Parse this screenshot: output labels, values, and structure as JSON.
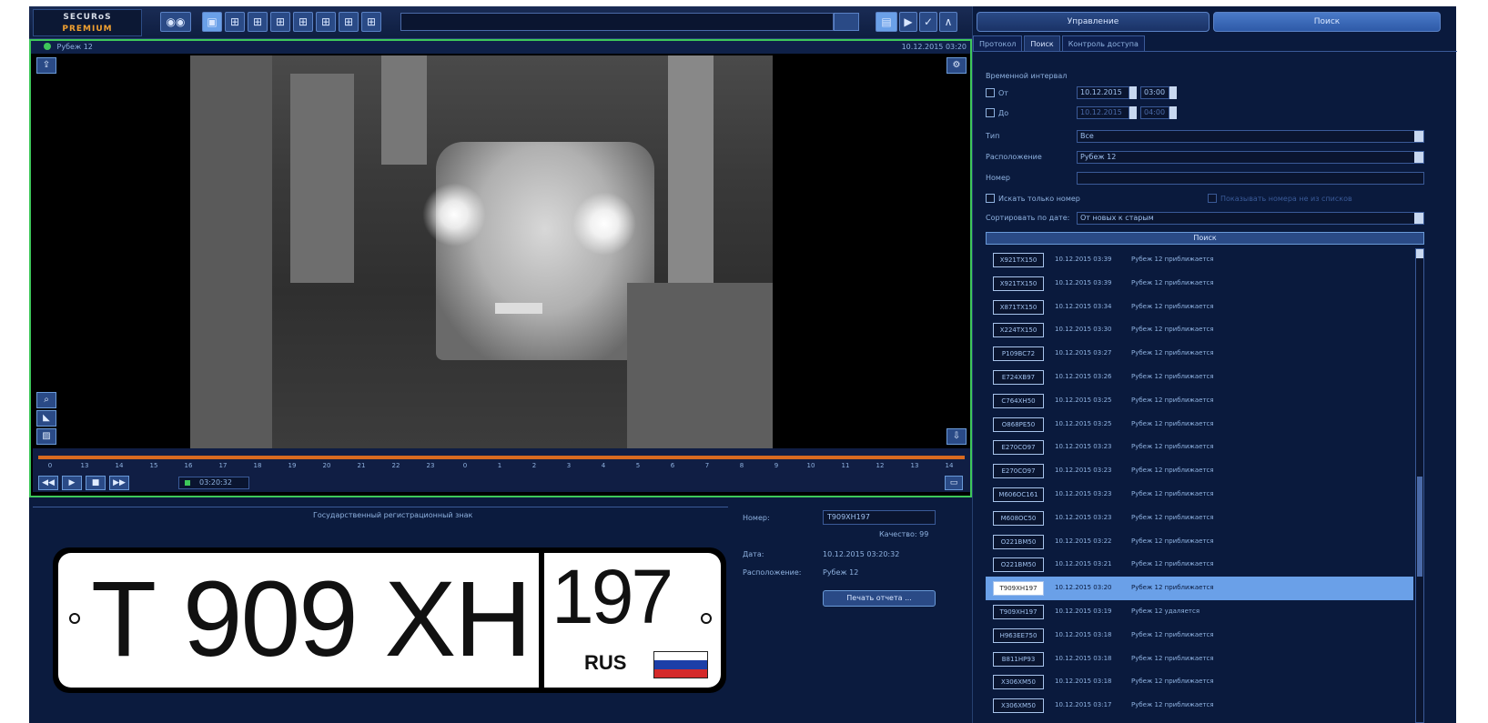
{
  "logo": {
    "line1": "SECURoS",
    "line2": "PREMIUM"
  },
  "toolbar": {
    "layout_buttons": [
      "◉◉",
      "▣",
      "⊞",
      "⊞",
      "⊞",
      "⊞",
      "⊞",
      "⊞",
      "⊞"
    ],
    "right_buttons": [
      "▤",
      "▶",
      "✓",
      "∧"
    ]
  },
  "camera": {
    "name": "Рубеж 12",
    "timestamp": "10.12.2015 03:20"
  },
  "timeline": {
    "ticks": [
      "0",
      "13",
      "14",
      "15",
      "16",
      "17",
      "18",
      "19",
      "20",
      "21",
      "22",
      "23",
      "0",
      "1",
      "2",
      "3",
      "4",
      "5",
      "6",
      "7",
      "8",
      "9",
      "10",
      "11",
      "12",
      "13",
      "14"
    ],
    "time": "03:20:32",
    "buttons": [
      "◀◀",
      "▶",
      "■",
      "▶▶"
    ]
  },
  "plate": {
    "group_title": "Государственный регистрационный знак",
    "number": "Т 909 ХН",
    "region": "197",
    "country": "RUS",
    "flag_colors": [
      "#ffffff",
      "#1c3fa8",
      "#d42a2a"
    ]
  },
  "info": {
    "number_label": "Номер:",
    "number_value": "Т909ХН197",
    "confidence": "Качество: 99",
    "date_label": "Дата:",
    "date_value": "10.12.2015 03:20:32",
    "location_label": "Расположение:",
    "location_value": "Рубеж 12",
    "print_button": "Печать отчета ..."
  },
  "right": {
    "top_btn_left": "Управление",
    "top_btn_right": "Поиск",
    "tabs": [
      "Протокол",
      "Поиск",
      "Контроль доступа"
    ],
    "form": {
      "interval_label": "Временной интервал",
      "from_label": "От",
      "from_date": "10.12.2015",
      "from_time": "03:00",
      "to_label": "До",
      "to_date": "10.12.2015",
      "to_time": "04:00",
      "type_label": "Тип",
      "type_value": "Все",
      "location_label": "Расположение",
      "location_value": "Рубеж 12",
      "number_label": "Номер",
      "number_value": "",
      "exact_label": "Искать только номер",
      "extra_label": "Показывать номера не из списков",
      "sort_label": "Сортировать по дате:",
      "sort_value": "От новых к старым",
      "search_button": "Поиск"
    },
    "results": [
      {
        "plate": "Х921ТХ150",
        "time": "10.12.2015 03:39",
        "event": "Рубеж 12 приближается"
      },
      {
        "plate": "Х921ТХ150",
        "time": "10.12.2015 03:39",
        "event": "Рубеж 12 приближается"
      },
      {
        "plate": "Х871ТХ150",
        "time": "10.12.2015 03:34",
        "event": "Рубеж 12 приближается"
      },
      {
        "plate": "Х224ТХ150",
        "time": "10.12.2015 03:30",
        "event": "Рубеж 12 приближается"
      },
      {
        "plate": "Р109ВС72",
        "time": "10.12.2015 03:27",
        "event": "Рубеж 12 приближается"
      },
      {
        "plate": "Е724ХВ97",
        "time": "10.12.2015 03:26",
        "event": "Рубеж 12 приближается"
      },
      {
        "plate": "С764ХН50",
        "time": "10.12.2015 03:25",
        "event": "Рубеж 12 приближается"
      },
      {
        "plate": "О868РЕ50",
        "time": "10.12.2015 03:25",
        "event": "Рубеж 12 приближается"
      },
      {
        "plate": "Е270СО97",
        "time": "10.12.2015 03:23",
        "event": "Рубеж 12 приближается"
      },
      {
        "plate": "Е270СО97",
        "time": "10.12.2015 03:23",
        "event": "Рубеж 12 приближается"
      },
      {
        "plate": "М606ОС161",
        "time": "10.12.2015 03:23",
        "event": "Рубеж 12 приближается"
      },
      {
        "plate": "М608ОС50",
        "time": "10.12.2015 03:23",
        "event": "Рубеж 12 приближается"
      },
      {
        "plate": "О221ВМ50",
        "time": "10.12.2015 03:22",
        "event": "Рубеж 12 приближается"
      },
      {
        "plate": "О221ВМ50",
        "time": "10.12.2015 03:21",
        "event": "Рубеж 12 приближается"
      },
      {
        "plate": "Т909ХН197",
        "time": "10.12.2015 03:20",
        "event": "Рубеж 12 приближается"
      },
      {
        "plate": "Т909ХН197",
        "time": "10.12.2015 03:19",
        "event": "Рубеж 12 удаляется"
      },
      {
        "plate": "Н963ЕЕ750",
        "time": "10.12.2015 03:18",
        "event": "Рубеж 12 приближается"
      },
      {
        "plate": "В811НР93",
        "time": "10.12.2015 03:18",
        "event": "Рубеж 12 приближается"
      },
      {
        "plate": "Х306ХМ50",
        "time": "10.12.2015 03:18",
        "event": "Рубеж 12 приближается"
      },
      {
        "plate": "Х306ХМ50",
        "time": "10.12.2015 03:17",
        "event": "Рубеж 12 приближается"
      }
    ],
    "selected_index": 14
  }
}
